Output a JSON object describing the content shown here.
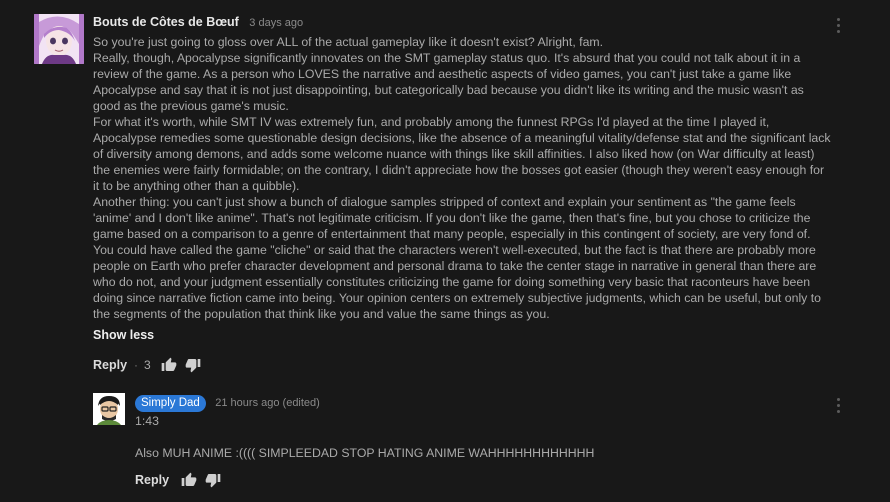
{
  "comment": {
    "author": "Bouts de Côtes de Bœuf",
    "time": "3 days ago",
    "paragraphs": [
      "So you're just going to gloss over ALL of the actual gameplay like it doesn't exist? Alright, fam.",
      "Really, though, Apocalypse significantly innovates on the SMT gameplay status quo. It's absurd that you could not talk about it in a review of the game. As a person who LOVES the narrative and aesthetic aspects of video games, you can't just take a game like Apocalypse and say that it is not just disappointing, but categorically bad because you didn't like its writing and the music wasn't as good as the previous game's music.",
      "For what it's worth, while SMT IV was extremely fun, and probably among the funnest RPGs I'd played at the time I played it, Apocalypse remedies some questionable design decisions, like the absence of a meaningful vitality/defense stat and the significant lack of diversity among demons, and adds some welcome nuance with things like skill affinities. I also liked how (on War difficulty at least) the enemies were fairly formidable; on the contrary, I didn't appreciate how the bosses got easier (though they weren't easy enough for it to be anything other than a quibble).",
      "Another thing: you can't just show a bunch of dialogue samples stripped of context and explain your sentiment as \"the game feels 'anime' and I don't like anime\". That's not legitimate criticism. If you don't like the game, then that's fine, but you chose to criticize the game based on a comparison to a genre of entertainment that many people, especially in this contingent of society, are very fond of. You could have called the game \"cliche\" or said that the characters weren't well-executed, but the fact is that there are probably more people on Earth who prefer character development and personal drama to take the center stage in narrative in general than there are who do not, and your judgment essentially constitutes criticizing the game for doing something very basic that raconteurs have been doing since narrative fiction came into being. Your opinion centers on extremely subjective judgments, which can be useful, but only to the segments of the population that think like you and value the same things as you."
    ],
    "show_less": "Show less",
    "reply_label": "Reply",
    "dot": "·",
    "like_count": "3",
    "icons": {
      "like": "thumbs-up-icon",
      "dislike": "thumbs-down-icon",
      "menu": "vertical-ellipsis-icon"
    }
  },
  "reply": {
    "author": "Simply Dad",
    "time": "21 hours ago (edited)",
    "lines": [
      "1:43",
      "",
      "Also MUH ANIME :(((( SIMPLEEDAD STOP HATING ANIME WAHHHHHHHHHHHH"
    ],
    "reply_label": "Reply",
    "author_badge_color": "#2b78d6"
  },
  "colors": {
    "background": "#181818",
    "text": "#aaaaaa",
    "author": "#e8e8e8"
  }
}
